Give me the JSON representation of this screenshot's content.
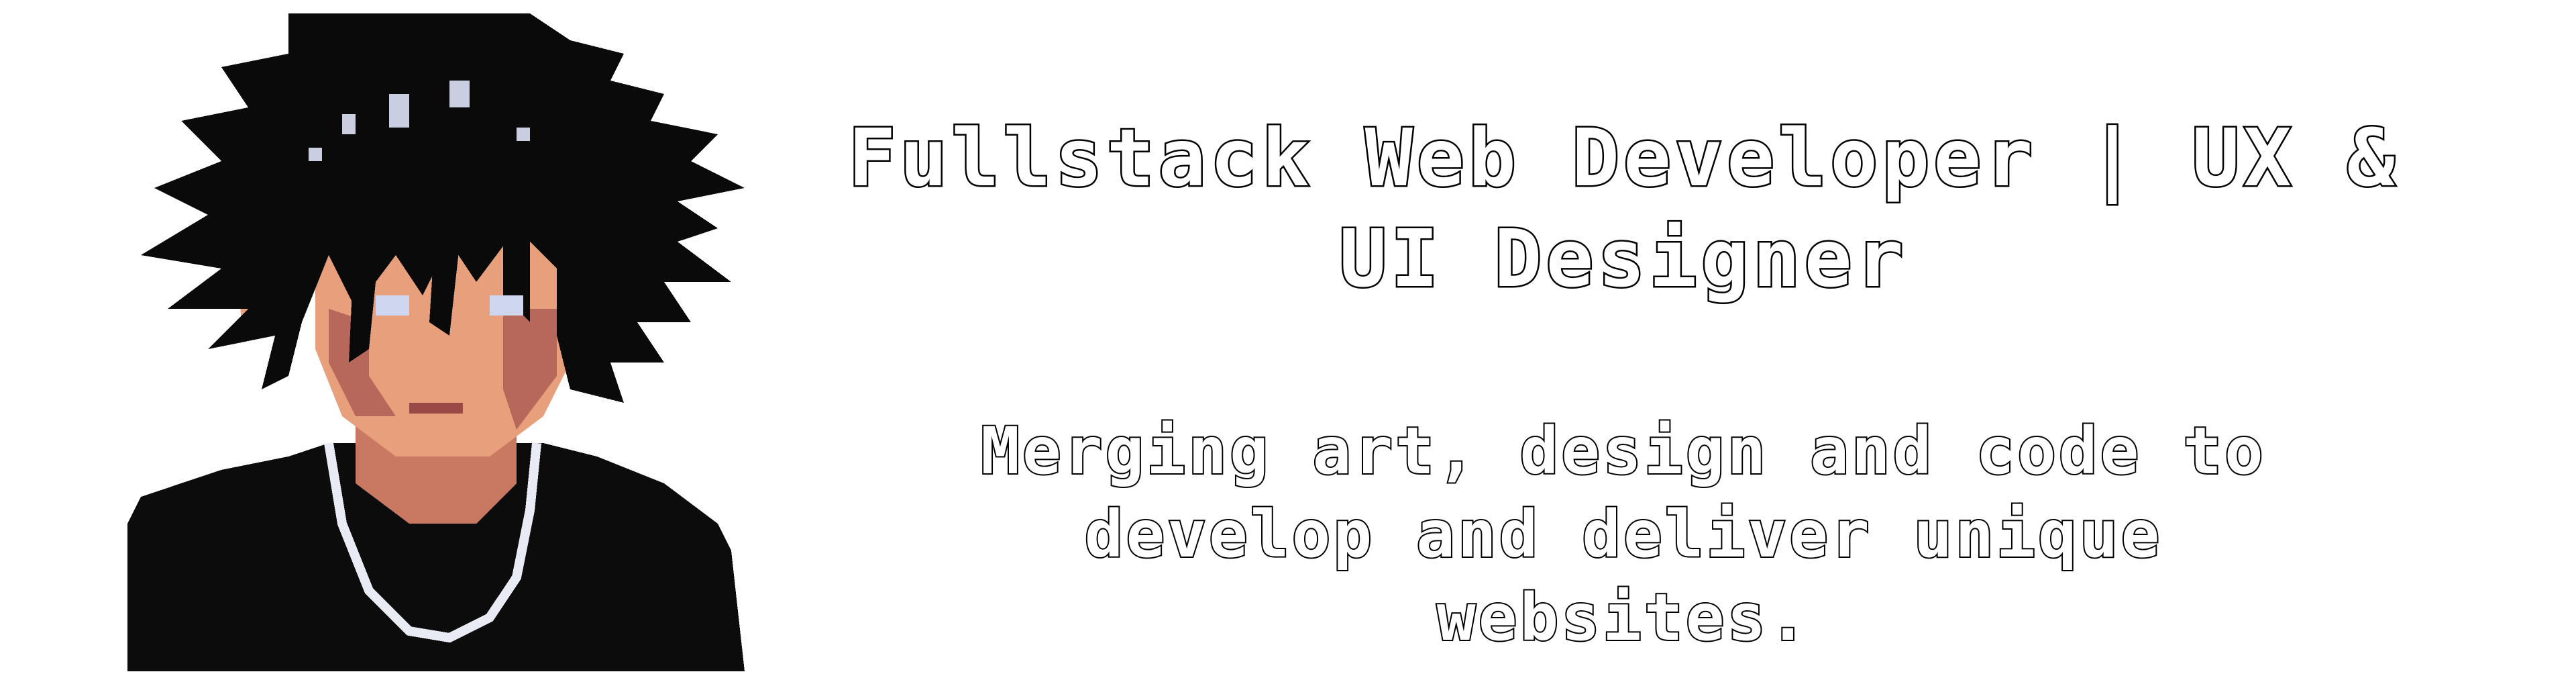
{
  "header": {
    "headline": "Fullstack Web Developer | UX & UI Designer",
    "tagline": "Merging art, design and code to develop and deliver unique websites."
  },
  "avatar": {
    "icon": "pixel-art-portrait",
    "colors": {
      "hair": "#0a0a0a",
      "hair_highlight": "#c9cfe0",
      "skin": "#e8a07c",
      "skin_shadow": "#b8685a",
      "eye": "#cfd6f0",
      "shirt": "#0c0c0c",
      "chain": "#e8ebf4"
    }
  }
}
